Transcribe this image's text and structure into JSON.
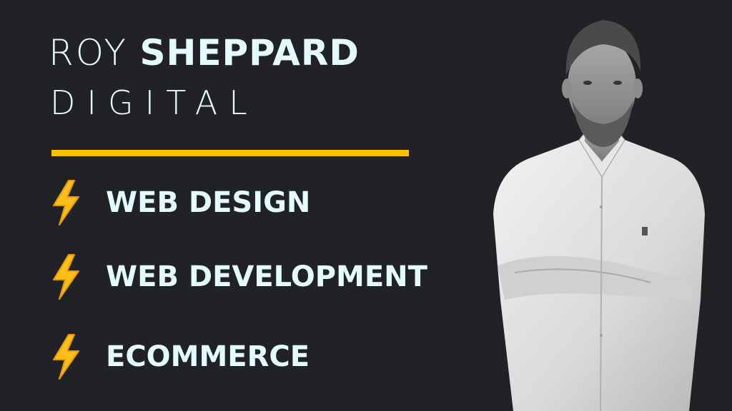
{
  "header": {
    "first_name": "ROY",
    "last_name": "SHEPPARD",
    "subtitle": "DIGITAL"
  },
  "divider_color": "#ffc000",
  "services": [
    {
      "label": "WEB DESIGN",
      "icon": "lightning-bolt-icon"
    },
    {
      "label": "WEB DEVELOPMENT",
      "icon": "lightning-bolt-icon"
    },
    {
      "label": "ECOMMERCE",
      "icon": "lightning-bolt-icon"
    }
  ],
  "colors": {
    "background": "#202226",
    "text": "#e4fbfd",
    "accent": "#ffc000"
  }
}
